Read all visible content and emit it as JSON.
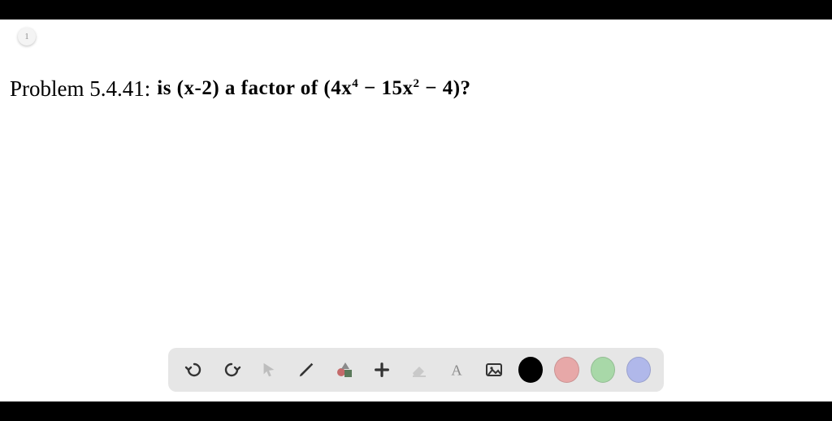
{
  "page": {
    "badge": "1"
  },
  "problem": {
    "label": "Problem 5.4.41:",
    "question_text": "is (x-2) a factor of (4x⁴ − 15x² − 4)?"
  },
  "toolbar": {
    "items": [
      {
        "name": "undo"
      },
      {
        "name": "redo"
      },
      {
        "name": "pointer"
      },
      {
        "name": "pencil"
      },
      {
        "name": "shapes"
      },
      {
        "name": "plus"
      },
      {
        "name": "eraser"
      },
      {
        "name": "text"
      },
      {
        "name": "image"
      }
    ],
    "colors": [
      {
        "name": "black",
        "hex": "#000000"
      },
      {
        "name": "red",
        "hex": "#e7a8a8"
      },
      {
        "name": "green",
        "hex": "#a8d8a8"
      },
      {
        "name": "blue",
        "hex": "#b0b8ea"
      }
    ]
  }
}
